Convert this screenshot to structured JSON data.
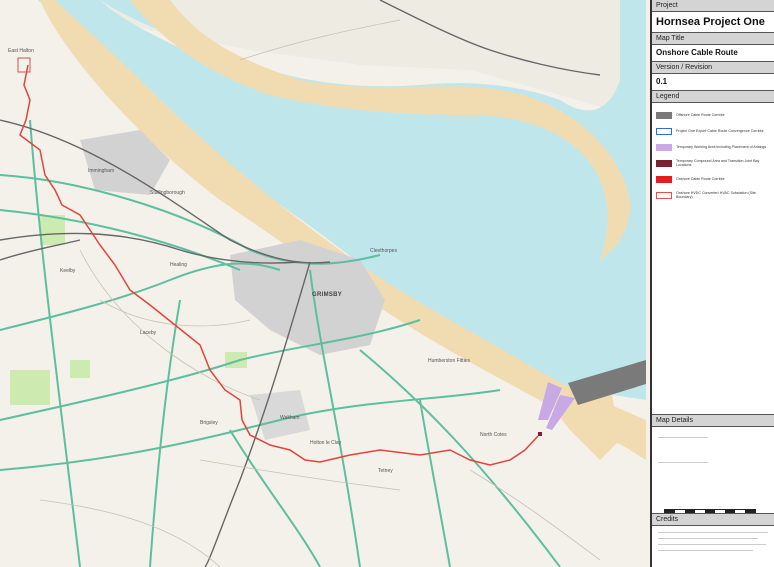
{
  "panel": {
    "project_label": "Project",
    "project_value": "Hornsea Project One",
    "map_title_label": "Map Title",
    "map_title_value": "Onshore Cable Route",
    "version_label": "Version / Revision",
    "version_value": "0.1",
    "legend_label": "Legend",
    "legend": [
      {
        "label": "Offshore Cable Route Corridor",
        "color": "#7a7a7a",
        "style": "fill"
      },
      {
        "label": "Project One Export Cable Route Convergence Corridor",
        "color": "#2f6fd6",
        "style": "outline"
      },
      {
        "label": "Temporary Working Area including Placement of Arisings",
        "color": "#c9a8e6",
        "style": "fill"
      },
      {
        "label": "Temporary Compound Area and Transition Joint Bay Locations",
        "color": "#7a2230",
        "style": "fill"
      },
      {
        "label": "Onshore Cable Route Corridor",
        "color": "#e02020",
        "style": "fill"
      },
      {
        "label": "Onshore HVDC Converter/ HVAC Substation (Site Boundary)",
        "color": "#e05050",
        "style": "outline"
      }
    ],
    "details_label": "Map Details",
    "credits_label": "Credits"
  },
  "map": {
    "colors": {
      "land": "#f4f1ea",
      "water": "#bfe6ea",
      "sand": "#f1dcb2",
      "route": "#e0443c",
      "road_major": "#5cbfa0",
      "rail": "#666666",
      "urban": "#d2d2d2",
      "green": "#cdeab0"
    },
    "places": [
      {
        "name": "GRIMSBY",
        "major": true
      },
      {
        "name": "Immingham",
        "major": false
      },
      {
        "name": "Humberston Fitties",
        "major": false
      },
      {
        "name": "Laceby",
        "major": false
      },
      {
        "name": "Keelby",
        "major": false
      },
      {
        "name": "Healing",
        "major": false
      },
      {
        "name": "Brigsley",
        "major": false
      },
      {
        "name": "Waltham",
        "major": false
      },
      {
        "name": "Holton le Clay",
        "major": false
      },
      {
        "name": "Tetney",
        "major": false
      },
      {
        "name": "North Cotes",
        "major": false
      },
      {
        "name": "Stallingborough",
        "major": false
      },
      {
        "name": "Cleethorpes",
        "major": false
      },
      {
        "name": "East Halton",
        "major": false
      }
    ]
  }
}
